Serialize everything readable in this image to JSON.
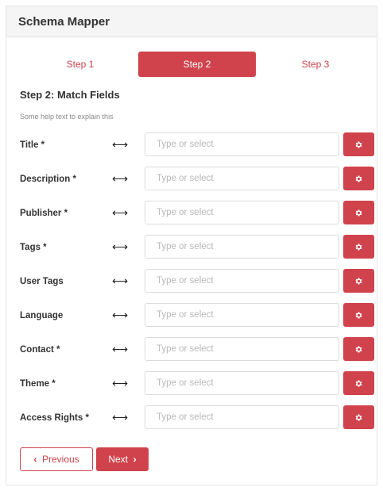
{
  "header": {
    "title": "Schema Mapper"
  },
  "steps": [
    {
      "label": "Step 1",
      "active": false
    },
    {
      "label": "Step 2",
      "active": true
    },
    {
      "label": "Step 3",
      "active": false
    }
  ],
  "section": {
    "title": "Step 2: Match Fields",
    "help": "Some help text to explain this"
  },
  "fields": [
    {
      "label": "Title *",
      "placeholder": "Type or select",
      "value": ""
    },
    {
      "label": "Description *",
      "placeholder": "Type or select",
      "value": ""
    },
    {
      "label": "Publisher *",
      "placeholder": "Type or select",
      "value": ""
    },
    {
      "label": "Tags *",
      "placeholder": "Type or select",
      "value": ""
    },
    {
      "label": "User Tags",
      "placeholder": "Type or select",
      "value": ""
    },
    {
      "label": "Language",
      "placeholder": "Type or select",
      "value": ""
    },
    {
      "label": "Contact *",
      "placeholder": "Type or select",
      "value": ""
    },
    {
      "label": "Theme *",
      "placeholder": "Type or select",
      "value": ""
    },
    {
      "label": "Access Rights *",
      "placeholder": "Type or select",
      "value": ""
    }
  ],
  "icons": {
    "arrow": "left-right-arrow-icon",
    "settings": "gear-icon",
    "previous": "chevron-left-icon",
    "next": "chevron-right-icon"
  },
  "buttons": {
    "previous": "Previous",
    "next": "Next"
  },
  "colors": {
    "accent": "#d0434c",
    "header_bg": "#f5f5f5"
  }
}
